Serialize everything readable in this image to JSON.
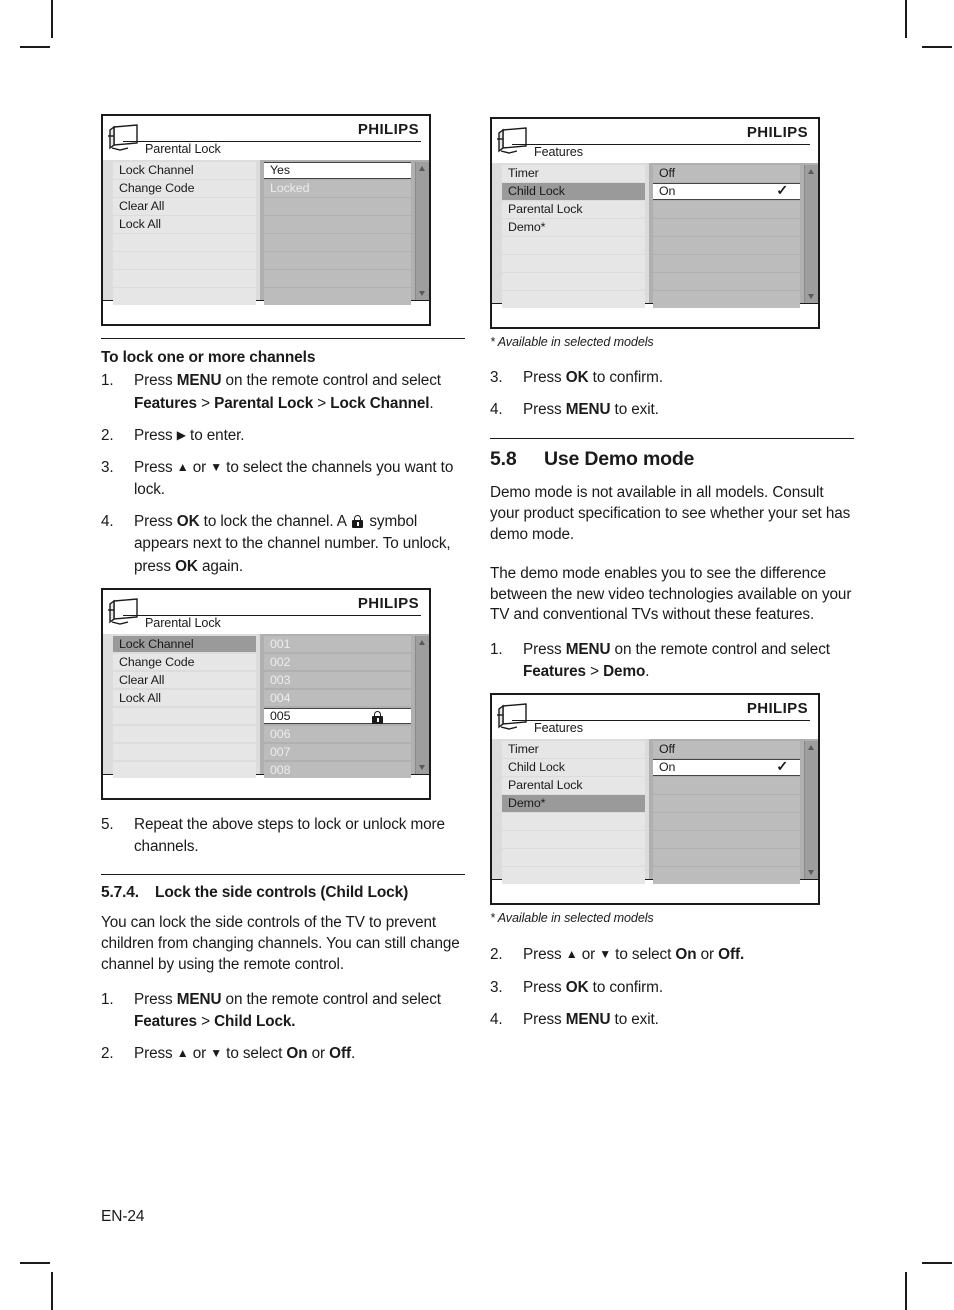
{
  "page": {
    "number": "EN-24",
    "footnote": "* Available in selected models"
  },
  "osd1": {
    "brand": "PHILIPS",
    "title": "Parental Lock",
    "left_items": [
      "Lock Channel",
      "Change Code",
      "Clear All",
      "Lock All"
    ],
    "left_selected_index": -1,
    "right_items": [
      "Yes",
      "Locked"
    ],
    "right_highlight_index": 0,
    "right_dim_index": 1
  },
  "osd2": {
    "brand": "PHILIPS",
    "title": "Features",
    "left_items": [
      "Timer",
      "Child Lock",
      "Parental Lock",
      "Demo*"
    ],
    "left_selected_index": 1,
    "right_items": [
      "Off",
      "On"
    ],
    "right_highlight_index": 1,
    "check_glyph": "✓"
  },
  "osd3": {
    "brand": "PHILIPS",
    "title": "Parental Lock",
    "left_items": [
      "Lock Channel",
      "Change Code",
      "Clear All",
      "Lock All"
    ],
    "left_selected_index": 0,
    "right_items": [
      "001",
      "002",
      "003",
      "004",
      "005",
      "006",
      "007",
      "008"
    ],
    "right_highlight_index": 4,
    "right_locked_index": 4
  },
  "osd4": {
    "brand": "PHILIPS",
    "title": "Features",
    "left_items": [
      "Timer",
      "Child Lock",
      "Parental Lock",
      "Demo*"
    ],
    "left_selected_index": 3,
    "right_items": [
      "Off",
      "On"
    ],
    "right_highlight_index": 1,
    "check_glyph": "✓"
  },
  "left_column": {
    "heading_lock_channels": "To lock one or more channels",
    "steps_lock": [
      {
        "num": "1.",
        "html": "Press <b>MENU</b> on the remote control and select <b>Features</b> > <b>Parental Lock</b> > <b>Lock Channel</b>."
      },
      {
        "num": "2.",
        "html": "Press <span class=\"arrow\">▶</span> to enter."
      },
      {
        "num": "3.",
        "html": "Press <span class=\"arrow\">▲</span> or <span class=\"arrow\">▼</span> to select the channels you want to lock."
      },
      {
        "num": "4.",
        "html": "Press <b>OK</b> to lock the channel. A <span class=\"lockglyph\"><span class=\"shackle\"></span><span class=\"bodyb\"></span></span> symbol appears next to the channel number. To unlock, press <b>OK</b> again."
      }
    ],
    "steps_after_osd": [
      {
        "num": "5.",
        "html": "Repeat the above steps to lock or unlock more channels."
      }
    ],
    "section_574_num": "5.7.4.",
    "section_574_title": "Lock the side controls (Child Lock)",
    "paragraph_childlock": "You can lock the side controls of the TV to prevent children from changing channels. You can still change channel by using the remote control.",
    "steps_childlock": [
      {
        "num": "1.",
        "html": "Press <b>MENU</b> on the remote control and select <b>Features</b> > <b>Child Lock.</b>"
      },
      {
        "num": "2.",
        "html": "Press <span class=\"arrow\">▲</span> or <span class=\"arrow\">▼</span> to select <b>On</b> or <b>Off</b>."
      }
    ]
  },
  "right_column": {
    "steps_childlock_cont": [
      {
        "num": "3.",
        "html": "Press <b>OK</b> to confirm."
      },
      {
        "num": "4.",
        "html": "Press <b>MENU</b> to exit."
      }
    ],
    "section_58_num": "5.8",
    "section_58_title": "Use Demo mode",
    "paragraph_demo_1": "Demo mode is not available in all models. Consult your product specification to see whether your set has demo mode.",
    "paragraph_demo_2": "The demo mode enables you to see the difference between the new video technologies available on your TV and conventional TVs without these features.",
    "steps_demo": [
      {
        "num": "1.",
        "html": "Press <b>MENU</b> on the remote control and select <b>Features</b> > <b>Demo</b>."
      }
    ],
    "steps_demo_after": [
      {
        "num": "2.",
        "html": "Press <span class=\"arrow\">▲</span> or <span class=\"arrow\">▼</span> to select <b>On</b> or <b>Off.</b>"
      },
      {
        "num": "3.",
        "html": "Press <b>OK</b> to confirm."
      },
      {
        "num": "4.",
        "html": "Press <b>MENU</b> to exit."
      }
    ]
  },
  "colors": {
    "ink": "#1a1a1a",
    "osd_left_panel": "#dcdcdc",
    "osd_left_row": "#e6e6e6",
    "osd_left_selected": "#9a9a9a",
    "osd_right_panel": "#b0b0b0",
    "osd_right_row": "#bcbcbc",
    "osd_highlight": "#ffffff",
    "osd_scrollbar": "#9e9e9e"
  }
}
